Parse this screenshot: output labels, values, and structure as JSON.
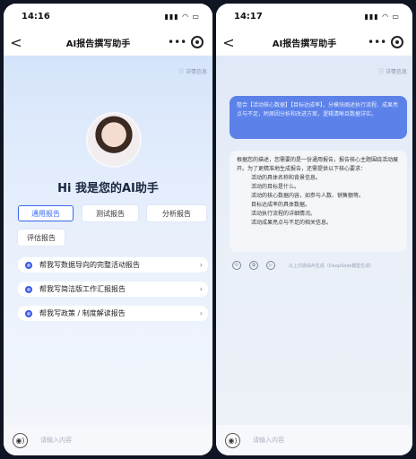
{
  "left": {
    "status": {
      "time": "14:16",
      "icons": "▮▮▮ ◠ ▭"
    },
    "nav": {
      "back": "<",
      "title": "AI报告撰写助手",
      "more": "•••"
    },
    "detail": "ⓘ 详情信息",
    "greeting": "Hi 我是您的AI助手",
    "tabs": [
      "通用报告",
      "测试报告",
      "分析报告",
      "评估报告"
    ],
    "suggestions": [
      {
        "label": "帮我写数据导向的完整活动报告",
        "arrow": "›"
      },
      {
        "label": "帮我写简洁版工作汇报报告",
        "arrow": "›"
      },
      {
        "label": "帮我写政策 / 制度解读报告",
        "arrow": "›"
      }
    ],
    "input": {
      "voice": "◉)",
      "placeholder": "请输入内容"
    }
  },
  "right": {
    "status": {
      "time": "14:17",
      "icons": "▮▮▮ ◠ ▭"
    },
    "nav": {
      "back": "<",
      "title": "AI报告撰写助手",
      "more": "•••"
    },
    "detail": "ⓘ 详情信息",
    "user_message": "整合【活动核心数据】【目标达成率】，分模块阐述执行流程、成果亮点与不足，附原因分析和改进方案，逻辑清晰且数据详实。",
    "bot_message": {
      "intro": "根据您的描述，您需要的是一份通用报告，报告核心主题围绕活动展开。为了更精准地生成报告，还需提供以下核心要求：",
      "items": [
        "活动的具体名称和背景信息。",
        "活动的目标是什么。",
        "活动的核心数据内容，如参与人数、销售额等。",
        "目标达成率的具体数据。",
        "活动执行流程的详细情况。",
        "活动成果亮点与不足的相关信息。"
      ]
    },
    "actions": [
      "↻",
      "⧉",
      "▷"
    ],
    "ai_note": "以上内容由AI生成（DeepSeek模型生成）",
    "input": {
      "voice": "◉)",
      "placeholder": "请输入内容"
    }
  }
}
